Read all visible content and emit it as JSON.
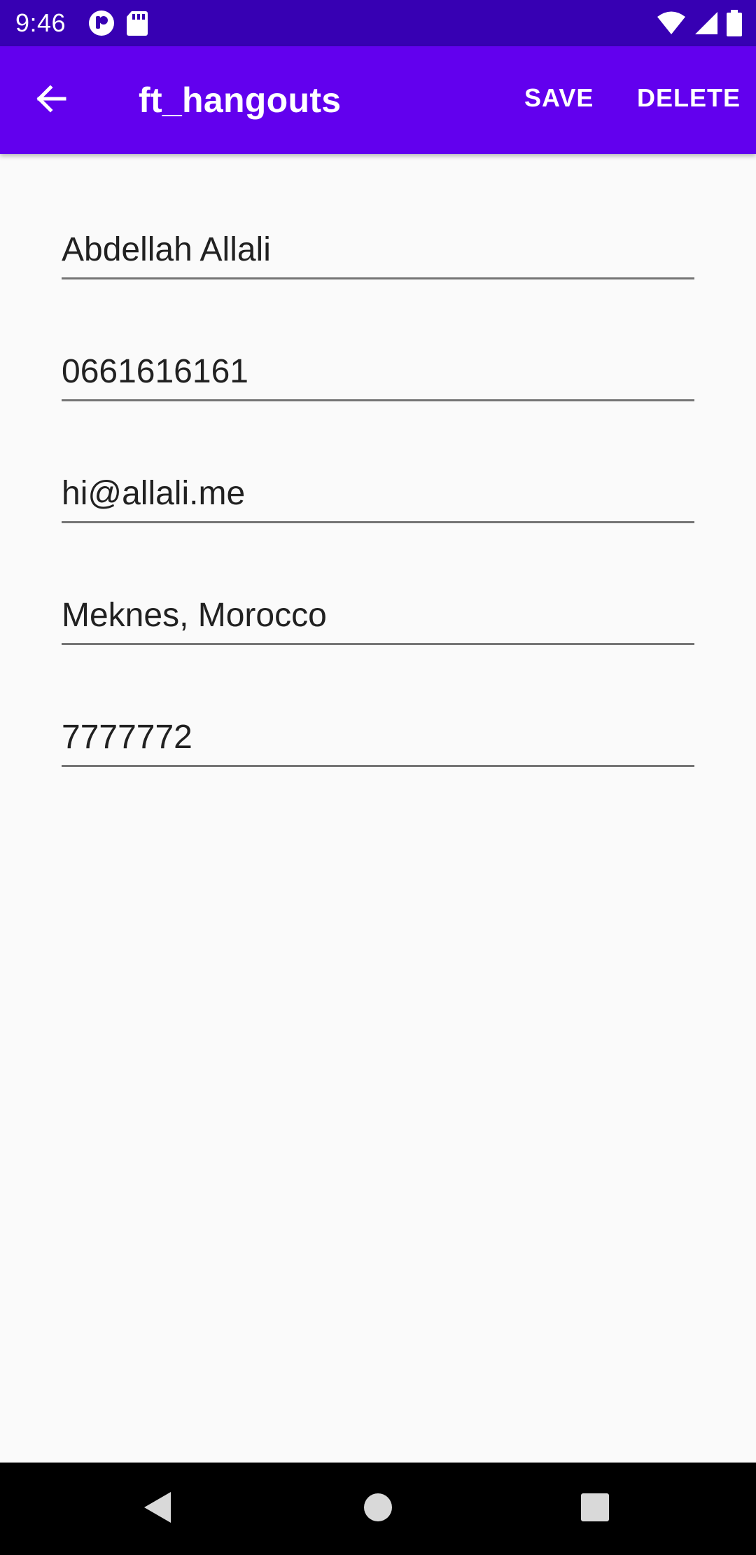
{
  "status_bar": {
    "time": "9:46",
    "icons_left": [
      "app-notification-icon",
      "sd-card-icon"
    ],
    "icons_right": [
      "wifi-icon",
      "signal-icon",
      "battery-icon"
    ]
  },
  "app_bar": {
    "title": "ft_hangouts",
    "back_icon": "arrow-back-icon",
    "actions": {
      "save": "SAVE",
      "delete": "DELETE"
    }
  },
  "form": {
    "name": "Abdellah Allali",
    "phone": "0661616161",
    "email": "hi@allali.me",
    "address": "Meknes, Morocco",
    "extra": "7777772"
  },
  "nav_bar": {
    "buttons": [
      "back-triangle-icon",
      "home-circle-icon",
      "recents-square-icon"
    ]
  },
  "colors": {
    "status_bar": "#3700b3",
    "app_bar": "#6200ee",
    "background": "#fafafa",
    "field_underline": "#757575",
    "text": "#212121",
    "nav_bar": "#000000"
  }
}
